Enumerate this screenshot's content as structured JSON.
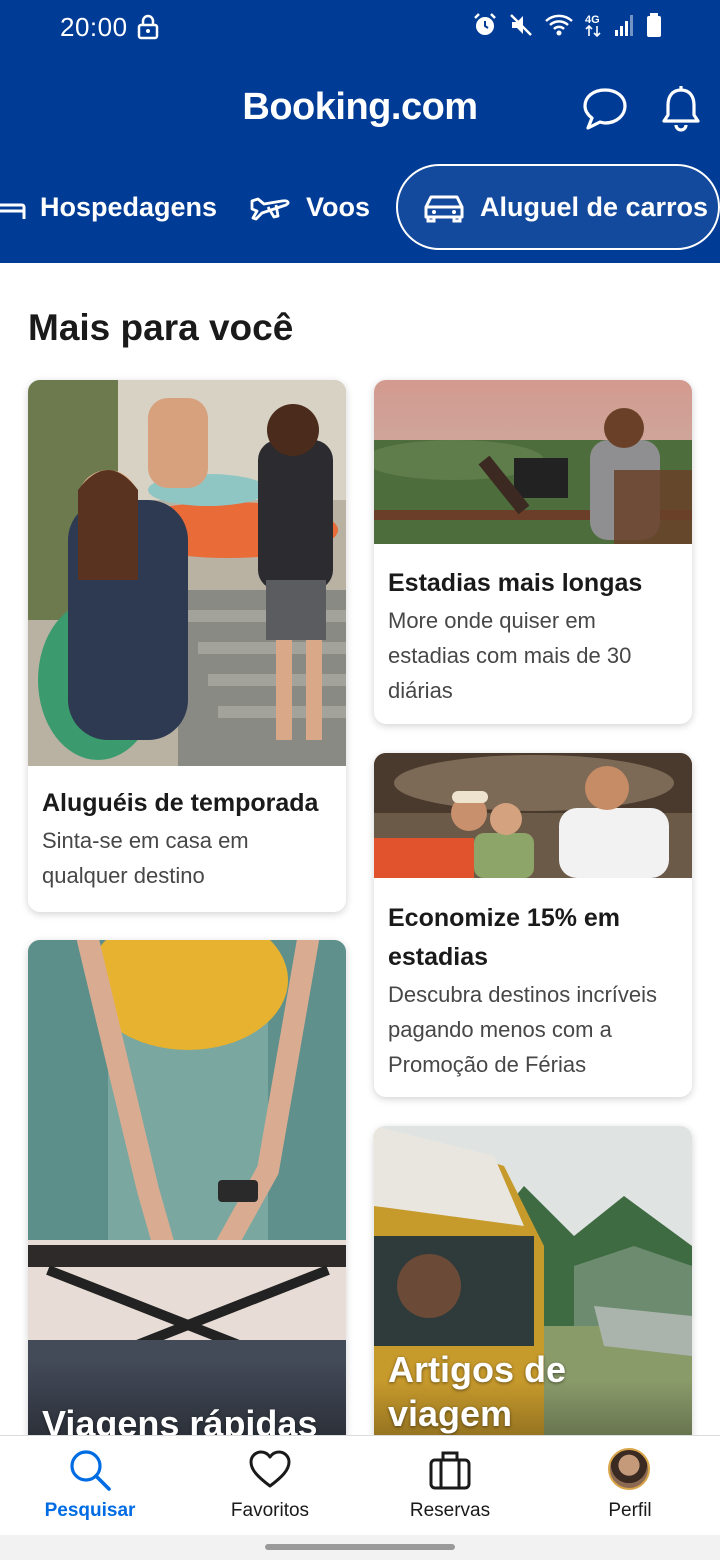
{
  "status_bar": {
    "time": "20:00",
    "icons": [
      "lock-icon",
      "alarm-icon",
      "mute-icon",
      "wifi-icon",
      "4g-icon",
      "signal-icon",
      "battery-icon"
    ]
  },
  "header": {
    "brand": "Booking.com",
    "chat_icon": "chat-bubble-icon",
    "bell_icon": "bell-icon"
  },
  "nav_tabs": [
    {
      "label": "Hospedagens",
      "icon": "bed-icon",
      "active": false
    },
    {
      "label": "Voos",
      "icon": "plane-icon",
      "active": false
    },
    {
      "label": "Aluguel de carros",
      "icon": "car-icon",
      "active": true
    }
  ],
  "section": {
    "title": "Mais para você",
    "cards": [
      {
        "title": "Aluguéis de temporada",
        "description": "Sinta-se em casa em qualquer destino"
      },
      {
        "title": "Estadias mais longas",
        "description": "More onde quiser em estadias com mais de 30 diárias"
      },
      {
        "title": "Economize 15% em estadias",
        "description": "Descubra destinos incríveis pagando menos com a Promoção de Férias"
      },
      {
        "title": "Viagens rápidas"
      },
      {
        "title": "Artigos de viagem"
      }
    ]
  },
  "bottom_nav": [
    {
      "label": "Pesquisar",
      "icon": "search-icon",
      "active": true
    },
    {
      "label": "Favoritos",
      "icon": "heart-icon",
      "active": false
    },
    {
      "label": "Reservas",
      "icon": "suitcase-icon",
      "active": false
    },
    {
      "label": "Perfil",
      "icon": "avatar",
      "active": false
    }
  ],
  "colors": {
    "brand_blue": "#003b95",
    "active_blue": "#006ce4",
    "text_dark": "#1a1a1a",
    "text_muted": "#474747"
  }
}
